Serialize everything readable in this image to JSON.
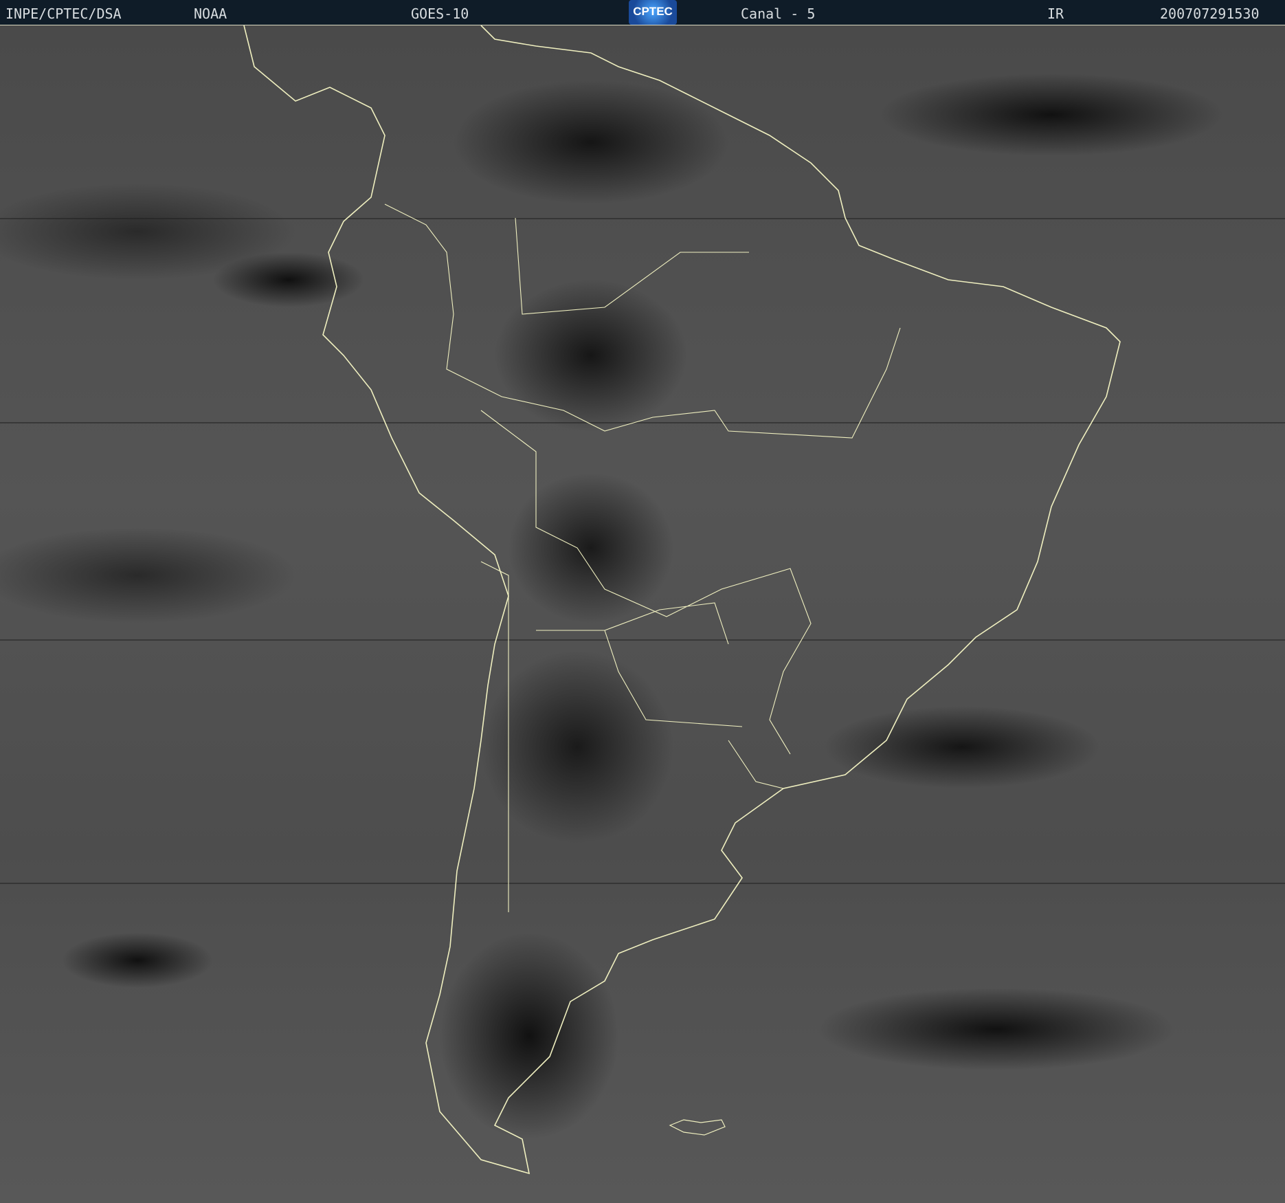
{
  "header": {
    "agency": "INPE/CPTEC/DSA",
    "source": "NOAA",
    "satellite": "GOES-10",
    "logo_text": "CPTEC",
    "channel": "Canal - 5",
    "band": "IR",
    "timestamp": "200707291530"
  },
  "colors": {
    "header_bg": "#0f1c28",
    "coastline": "#f0f0c0",
    "header_text": "#d8dde0"
  }
}
